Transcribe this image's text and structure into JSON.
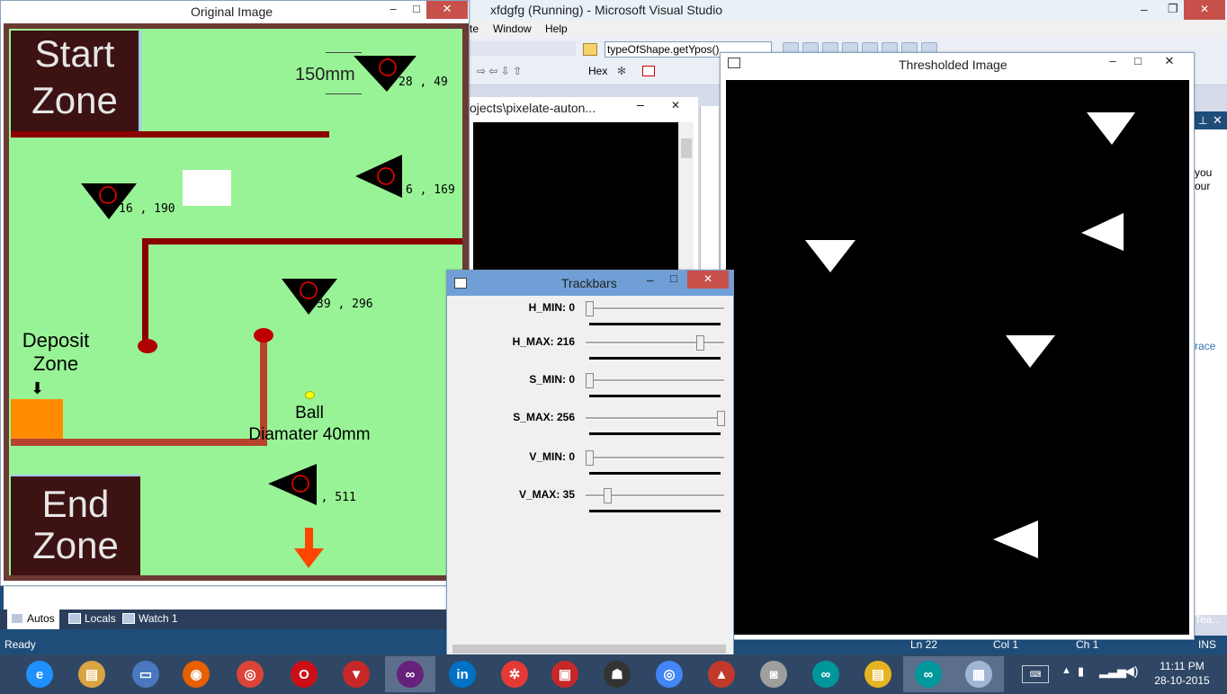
{
  "vs": {
    "title": "xfdgfg (Running) - Microsoft Visual Studio",
    "menu": [
      "te",
      "Window",
      "Help"
    ],
    "find_text": "typeOfShape.getYpos()",
    "hex_label": "Hex",
    "path_panel": "ojects\\pixelate-auton...",
    "side_text": [
      "you",
      "our",
      "race"
    ],
    "side_bottom": "Tea...",
    "tabs": [
      "Autos",
      "Locals",
      "Watch 1"
    ],
    "status": {
      "ready": "Ready",
      "ln": "Ln 22",
      "col": "Col 1",
      "ch": "Ch 1",
      "ins": "INS"
    }
  },
  "original": {
    "title": "Original Image",
    "start_zone": [
      "Start",
      "Zone"
    ],
    "end_zone": [
      "End",
      "Zone"
    ],
    "deposit_zone": [
      "Deposit",
      "Zone"
    ],
    "deposit_arrow": "⬇",
    "distance": "150mm",
    "ball": [
      "Ball",
      "Diamater 40mm"
    ],
    "coords": [
      "28 , 49",
      "6 , 169",
      "16 , 190",
      "39 , 296",
      "9 , 511"
    ]
  },
  "thresholded": {
    "title": "Thresholded Image"
  },
  "trackbars": {
    "title": "Trackbars",
    "items": [
      {
        "label": "H_MIN: 0",
        "value": 0,
        "max": 256
      },
      {
        "label": "H_MAX: 216",
        "value": 216,
        "max": 256
      },
      {
        "label": "S_MIN: 0",
        "value": 0,
        "max": 256
      },
      {
        "label": "S_MAX: 256",
        "value": 256,
        "max": 256
      },
      {
        "label": "V_MIN: 0",
        "value": 0,
        "max": 256
      },
      {
        "label": "V_MAX: 35",
        "value": 35,
        "max": 256
      }
    ]
  },
  "taskbar": {
    "apps": [
      "ie-icon",
      "explorer-icon",
      "lenovo-icon",
      "firefox-icon",
      "chrome-icon",
      "opera-icon",
      "media-icon",
      "vs-icon",
      "intel-icon",
      "wheel-icon",
      "tv-icon",
      "cs-icon",
      "chrome2-icon",
      "app-icon",
      "camera-icon",
      "arduino-icon",
      "notes-icon",
      "arduino2-icon",
      "window-icon"
    ],
    "time": "11:11 PM",
    "date": "28-10-2015"
  },
  "colors": {
    "field": "#98f396",
    "zone": "#3d1212",
    "wall": "#8b0000",
    "close": "#c7514a",
    "taskbar": "#2f4765"
  }
}
